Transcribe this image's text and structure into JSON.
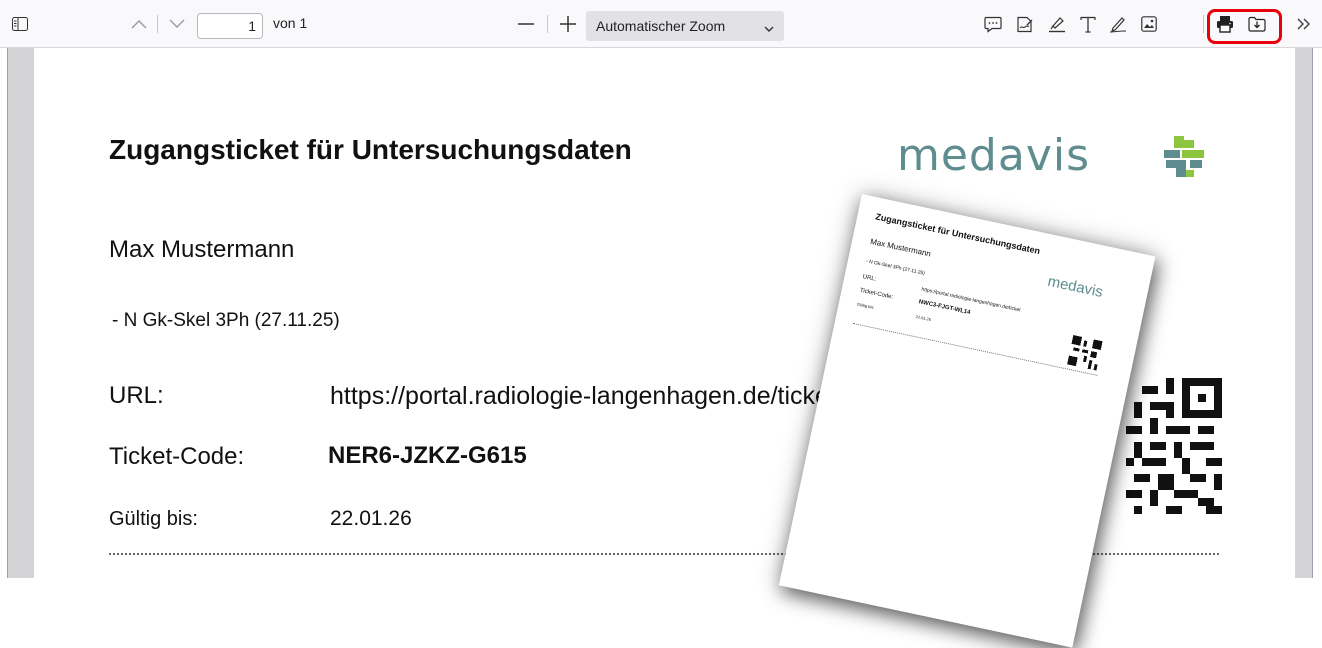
{
  "toolbar": {
    "page_number": "1",
    "of_pages": "von 1",
    "zoom": "Automatischer Zoom",
    "icons": [
      "sidebar-toggle-icon",
      "previous-page-icon",
      "next-page-icon",
      "zoom-out-icon",
      "zoom-in-icon",
      "comment-icon",
      "signature-icon",
      "highlight-icon",
      "text-icon",
      "draw-icon",
      "image-icon",
      "print-icon",
      "save-icon",
      "more-tools-icon"
    ],
    "highlight_color": "#e8000a"
  },
  "document": {
    "title": "Zugangsticket für Untersuchungsdaten",
    "logo": "medavis",
    "patient_name": "Max Mustermann",
    "exam": "-  N Gk-Skel 3Ph (27.11.25)",
    "url_label": "URL:",
    "url_value": "https://portal.radiologie-langenhagen.de/ticket",
    "ticket_label": "Ticket-Code:",
    "ticket_code": "NER6-JZKZ-G615",
    "valid_label": "Gültig bis:",
    "valid_date": "22.01.26",
    "brand_color": "#5e8c8f"
  },
  "thumbnail": {
    "title": "Zugangsticket für Untersuchungsdaten",
    "logo": "medavis",
    "patient_name": "Max Mustermann",
    "exam": "- N Gk-Skel 3Ph (27.11.25)",
    "url_label": "URL:",
    "url_value": "https://portal.radiologie-langenhagen.de/ticket",
    "ticket_label": "Ticket-Code:",
    "ticket_code": "NWC3-FJGT-WL14",
    "valid_label": "Gültig bis:",
    "valid_date": "22.01.26"
  }
}
